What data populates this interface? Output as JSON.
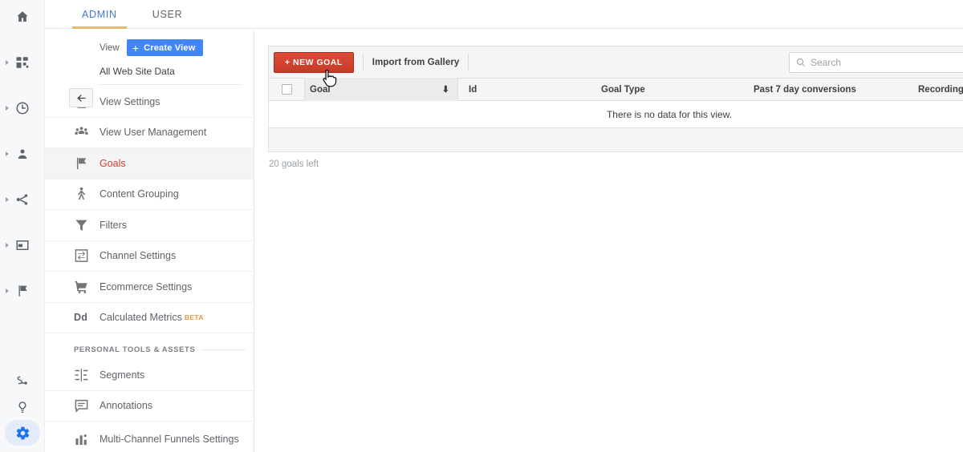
{
  "rail": {
    "items": [
      {
        "name": "home",
        "icon": "home-icon",
        "caret": false
      },
      {
        "name": "dashboards",
        "icon": "dashboard-grid-icon",
        "caret": true
      },
      {
        "name": "realtime",
        "icon": "clock-icon",
        "caret": true
      },
      {
        "name": "audience",
        "icon": "person-icon",
        "caret": true
      },
      {
        "name": "acquisition",
        "icon": "share-branch-icon",
        "caret": true
      },
      {
        "name": "behavior",
        "icon": "window-icon",
        "caret": true
      },
      {
        "name": "conversions",
        "icon": "flag-icon",
        "caret": true
      }
    ],
    "bottom": [
      {
        "name": "attribution",
        "icon": "path-squiggle-icon"
      },
      {
        "name": "discover",
        "icon": "lightbulb-icon"
      },
      {
        "name": "admin",
        "icon": "gear-icon",
        "active": true
      }
    ],
    "accent_active": "#1a73e8",
    "accent_pill": "#e4ecfb"
  },
  "tabs": [
    {
      "label": "ADMIN",
      "active": true
    },
    {
      "label": "USER",
      "active": false
    }
  ],
  "tab_underline_color": "#e8b96c",
  "tab_active_color": "#3c78d8",
  "sidebar": {
    "view_label": "View",
    "create_view_button": "Create View",
    "create_view_plus": "+",
    "view_name": "All Web Site Data",
    "back_button": "back-arrow",
    "items": [
      {
        "label": "View Settings",
        "icon": "document-icon"
      },
      {
        "label": "View User Management",
        "icon": "people-icon"
      },
      {
        "label": "Goals",
        "icon": "flag-icon",
        "active": true
      },
      {
        "label": "Content Grouping",
        "icon": "person-branch-icon"
      },
      {
        "label": "Filters",
        "icon": "funnel-icon"
      },
      {
        "label": "Channel Settings",
        "icon": "channel-arrows-icon"
      },
      {
        "label": "Ecommerce Settings",
        "icon": "shopping-cart-icon"
      },
      {
        "label": "Calculated Metrics",
        "icon": "dd-text-icon",
        "badge": "BETA"
      }
    ],
    "section_title": "PERSONAL TOOLS & ASSETS",
    "personal_items": [
      {
        "label": "Segments",
        "icon": "segments-icon"
      },
      {
        "label": "Annotations",
        "icon": "annotation-bubble-icon"
      },
      {
        "label": "Multi-Channel Funnels Settings",
        "icon": "bar-chart-icon"
      }
    ],
    "active_item_color": "#d23f31"
  },
  "main": {
    "new_goal_button": "+ NEW GOAL",
    "import_link": "Import from Gallery",
    "search_placeholder": "Search",
    "search_value": "",
    "table": {
      "columns": [
        "Goal",
        "Id",
        "Goal Type",
        "Past 7 day conversions",
        "Recording"
      ],
      "sorted_column": "Goal",
      "sort_direction": "desc",
      "sort_glyph": "⬇",
      "rows": [],
      "empty_message": "There is no data for this view."
    },
    "goals_left": "20 goals left",
    "new_goal_color": "#c63b28"
  }
}
